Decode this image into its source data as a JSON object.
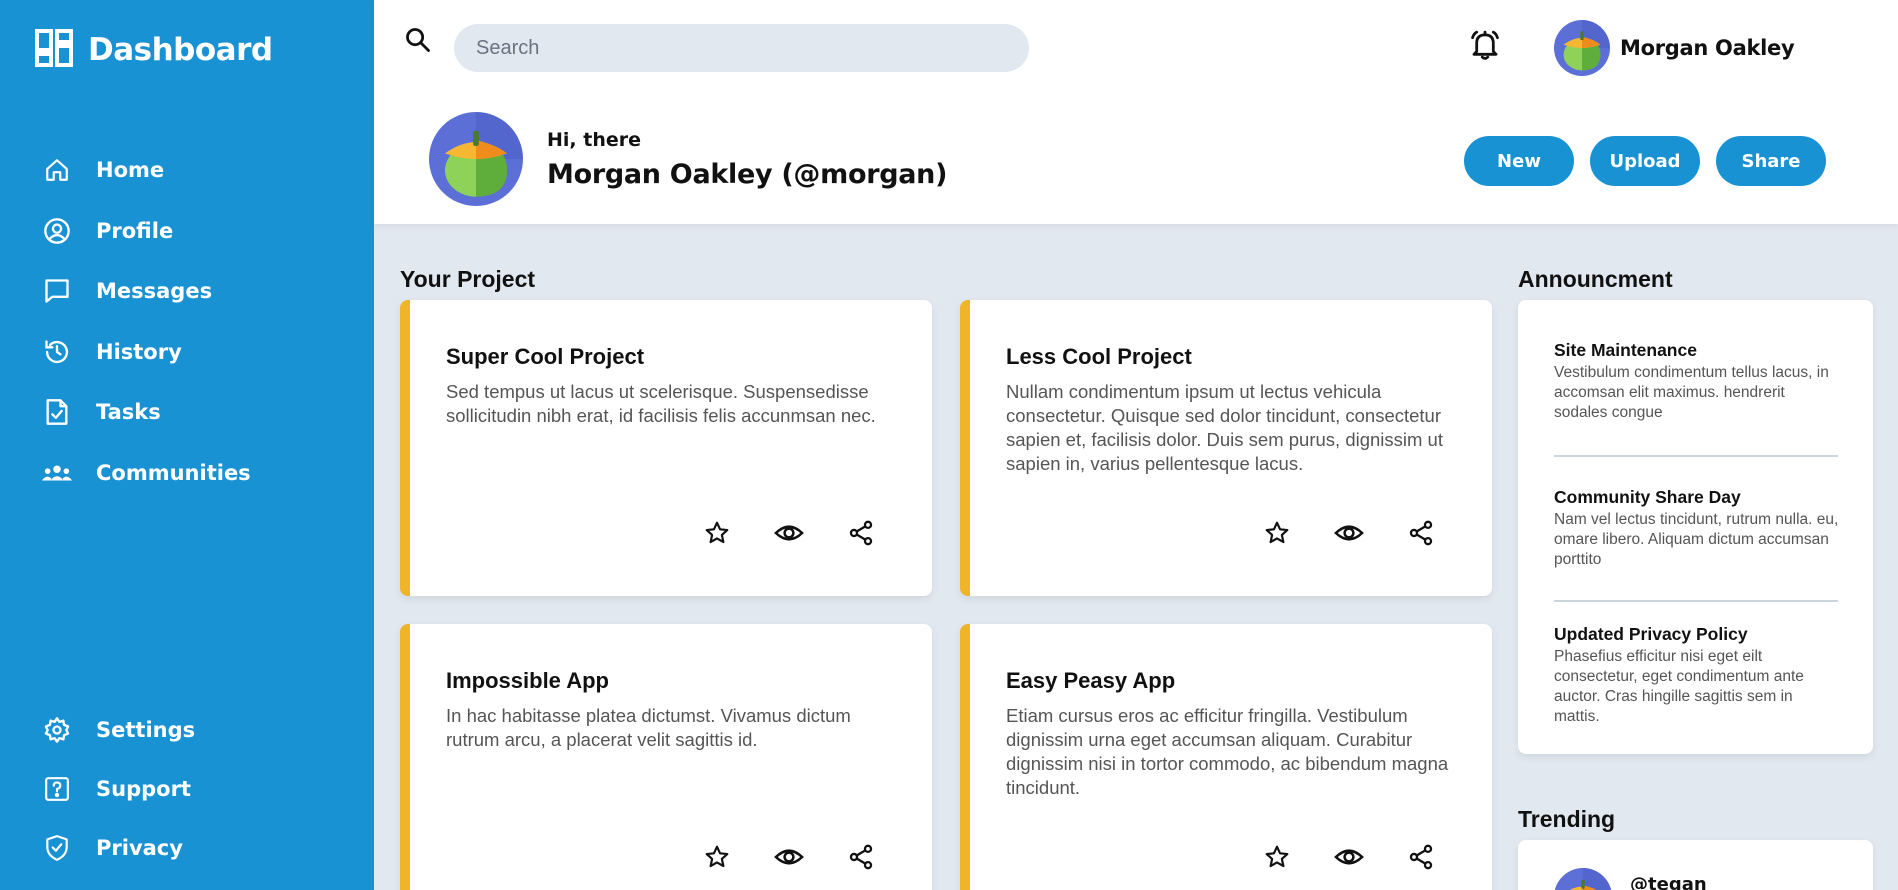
{
  "brand": {
    "title": "Dashboard"
  },
  "sidebar": {
    "items": [
      {
        "label": "Home",
        "icon": "home-icon"
      },
      {
        "label": "Profile",
        "icon": "user-circle-icon"
      },
      {
        "label": "Messages",
        "icon": "message-icon"
      },
      {
        "label": "History",
        "icon": "history-icon"
      },
      {
        "label": "Tasks",
        "icon": "tasks-icon"
      },
      {
        "label": "Communities",
        "icon": "communities-icon"
      }
    ],
    "bottom_items": [
      {
        "label": "Settings",
        "icon": "gear-icon"
      },
      {
        "label": "Support",
        "icon": "help-icon"
      },
      {
        "label": "Privacy",
        "icon": "shield-icon"
      }
    ]
  },
  "header": {
    "search": {
      "placeholder": "Search",
      "value": ""
    },
    "user_name": "Morgan Oakley",
    "greeting": "Hi, there",
    "display_name": "Morgan Oakley (@morgan)",
    "actions": {
      "new": "New",
      "upload": "Upload",
      "share": "Share"
    }
  },
  "projects": {
    "title": "Your Project",
    "items": [
      {
        "title": "Super Cool Project",
        "description": "Sed tempus ut lacus ut scelerisque. Suspensedisse sollicitudin nibh erat, id facilisis felis accunmsan nec."
      },
      {
        "title": "Less Cool Project",
        "description": "Nullam condimentum ipsum ut lectus vehicula consectetur. Quisque sed dolor tincidunt, consectetur sapien et, facilisis dolor. Duis sem purus, dignissim ut sapien in, varius pellentesque lacus."
      },
      {
        "title": "Impossible App",
        "description": "In hac habitasse platea dictumst. Vivamus dictum rutrum arcu, a placerat velit sagittis id."
      },
      {
        "title": "Easy Peasy App",
        "description": "Etiam cursus eros ac efficitur fringilla. Vestibulum dignissim urna eget accumsan aliquam. Curabitur dignissim nisi in tortor commodo, ac bibendum magna tincidunt."
      }
    ]
  },
  "announcements": {
    "title": "Announcment",
    "items": [
      {
        "title": "Site Maintenance",
        "text": "Vestibulum condimentum tellus lacus, in accomsan elit maximus. hendrerit sodales congue"
      },
      {
        "title": "Community Share Day",
        "text": "Nam vel lectus tincidunt, rutrum nulla. eu, omare libero. Aliquam dictum accumsan porttito"
      },
      {
        "title": "Updated Privacy Policy",
        "text": "Phasefius efficitur nisi eget eilt consectetur, eget condimentum ante auctor. Cras hingille sagittis sem in mattis."
      }
    ]
  },
  "trending": {
    "title": "Trending",
    "first_user": "@tegan"
  },
  "colors": {
    "primary": "#1992d4",
    "accent": "#f0b429",
    "background": "#e2e8f0"
  }
}
